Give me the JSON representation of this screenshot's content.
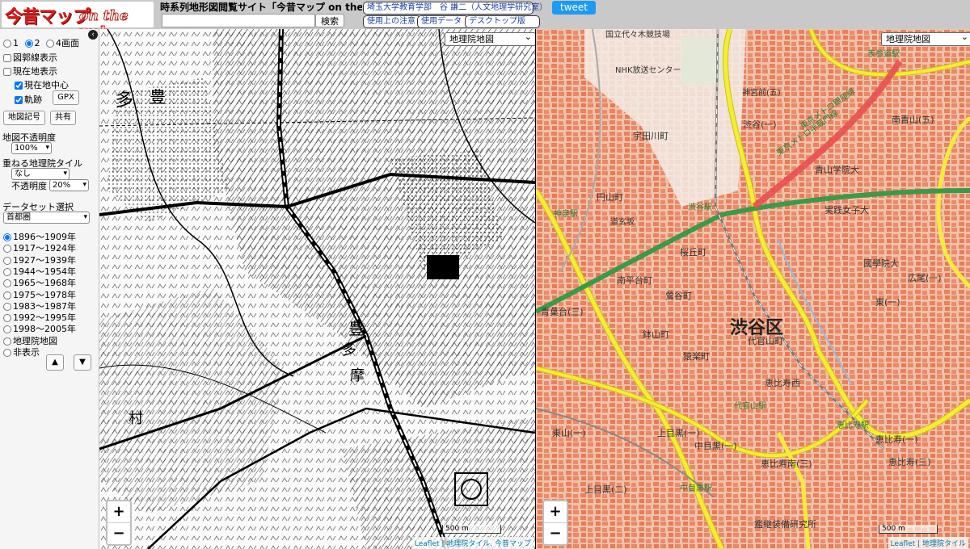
{
  "header": {
    "logo_kanji": "今昔マップ",
    "logo_roman": "on the web",
    "site_title": "時系列地形図閲覧サイト「今昔マップ on the web」",
    "search_placeholder": "",
    "search_label": "検索",
    "author_label": "埼玉大学教育学部　谷 謙二（人文地理学研究室）",
    "usage_label": "使用上の注意",
    "data_label": "使用データ",
    "desktop_label": "デスクトップ版",
    "tweet_label": "tweet"
  },
  "sidebar": {
    "screen_options": [
      "1",
      "2",
      "4画面"
    ],
    "screen_selected": "2",
    "grid_label": "図郭線表示",
    "location_label": "現在地表示",
    "center_label": "現在地中心",
    "track_label": "軌跡",
    "gpx_label": "GPX",
    "legend_label": "地図記号",
    "share_label": "共有",
    "opacity_title": "地図不透明度",
    "opacity_value": "100%",
    "overlay_title": "重ねる地理院タイル",
    "overlay_value": "なし",
    "transparency_label": "不透明度",
    "transparency_value": "20%",
    "dataset_title": "データセット選択",
    "dataset_value": "首都圏",
    "periods": [
      "1896〜1909年",
      "1917〜1924年",
      "1927〜1939年",
      "1944〜1954年",
      "1965〜1968年",
      "1975〜1978年",
      "1983〜1987年",
      "1992〜1995年",
      "1998〜2005年",
      "地理院地図",
      "非表示"
    ],
    "period_selected": "1896〜1909年",
    "up_label": "▲",
    "down_label": "▼",
    "collapse_label": "‹"
  },
  "left_map": {
    "layer_label": "地理院地図",
    "labels": [
      "多",
      "豊",
      "豊",
      "多",
      "摩",
      "村"
    ],
    "scale_label": "500 m",
    "attribution": "Leaflet | 地理院タイル, 今昔マップ"
  },
  "right_map": {
    "layer_label": "地理院地図",
    "labels": [
      "国立代々木競技場",
      "NHK放送センター",
      "神宮前(五)",
      "渋谷(一)",
      "渋谷駅",
      "表参道駅",
      "南青山(五)",
      "宇田川町",
      "神泉駅",
      "円山町",
      "道玄坂",
      "南平台町",
      "桜丘町",
      "鶯谷町",
      "青葉台(三)",
      "鉢山町",
      "渋谷区",
      "代官山町",
      "猿楽町",
      "恵比寿西",
      "恵比寿駅",
      "恵比寿南(三)",
      "東(一)",
      "広尾(一)",
      "東京メトロ銀座線",
      "東京メトロ半蔵門線",
      "國學院大",
      "実践女子大",
      "青山学院大",
      "代官山駅",
      "上目黒(一)",
      "中目黒(一)",
      "中目黒駅",
      "上目黒(二)",
      "恵比寿(一)",
      "恵比寿(三)",
      "鑑継装備研究所",
      "東山(一)"
    ],
    "scale_label": "500 m",
    "attribution": "Leaflet | 地理院タイル"
  },
  "zoom": {
    "in_label": "+",
    "out_label": "−"
  }
}
